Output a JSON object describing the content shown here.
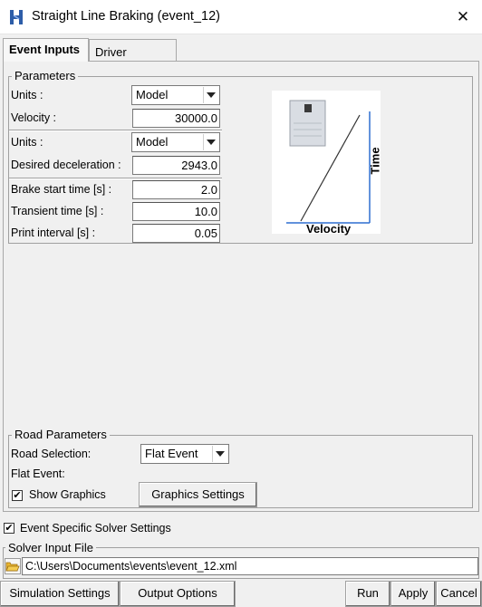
{
  "window": {
    "title": "Straight Line Braking (event_12)"
  },
  "tabs": [
    {
      "label": "Event Inputs",
      "active": true
    },
    {
      "label": "Driver",
      "active": false
    }
  ],
  "parameters": {
    "title": "Parameters",
    "units1_label": "Units :",
    "units1_value": "Model",
    "velocity_label": "Velocity :",
    "velocity_value": "30000.0",
    "units2_label": "Units :",
    "units2_value": "Model",
    "decel_label": "Desired deceleration :",
    "decel_value": "2943.0",
    "brake_start_label": "Brake start time [s] :",
    "brake_start_value": "2.0",
    "transient_label": "Transient time [s] :",
    "transient_value": "10.0",
    "print_label": "Print interval [s] :",
    "print_value": "0.05"
  },
  "diagram": {
    "y_label": "Time",
    "x_label": "Velocity"
  },
  "road": {
    "title": "Road Parameters",
    "selection_label": "Road Selection:",
    "selection_value": "Flat Event",
    "flat_event_label": "Flat Event:",
    "show_graphics_label": "Show Graphics",
    "show_graphics_checked": true,
    "graphics_settings_button": "Graphics Settings"
  },
  "solver": {
    "event_specific_label": "Event Specific Solver Settings",
    "event_specific_checked": true,
    "input_file_title": "Solver Input File",
    "input_file_path": "C:\\Users\\Documents\\events\\event_12.xml"
  },
  "buttons": {
    "simulation_settings": "Simulation Settings",
    "output_options": "Output Options",
    "run": "Run",
    "apply": "Apply",
    "cancel": "Cancel"
  },
  "icons": {
    "app": "hyperworks-h-icon",
    "close": "close-icon",
    "folder": "open-folder-icon",
    "dropdown": "chevron-down-icon"
  },
  "colors": {
    "app_icon": "#2d5da8",
    "diagram_axis": "#2f6fd0"
  }
}
